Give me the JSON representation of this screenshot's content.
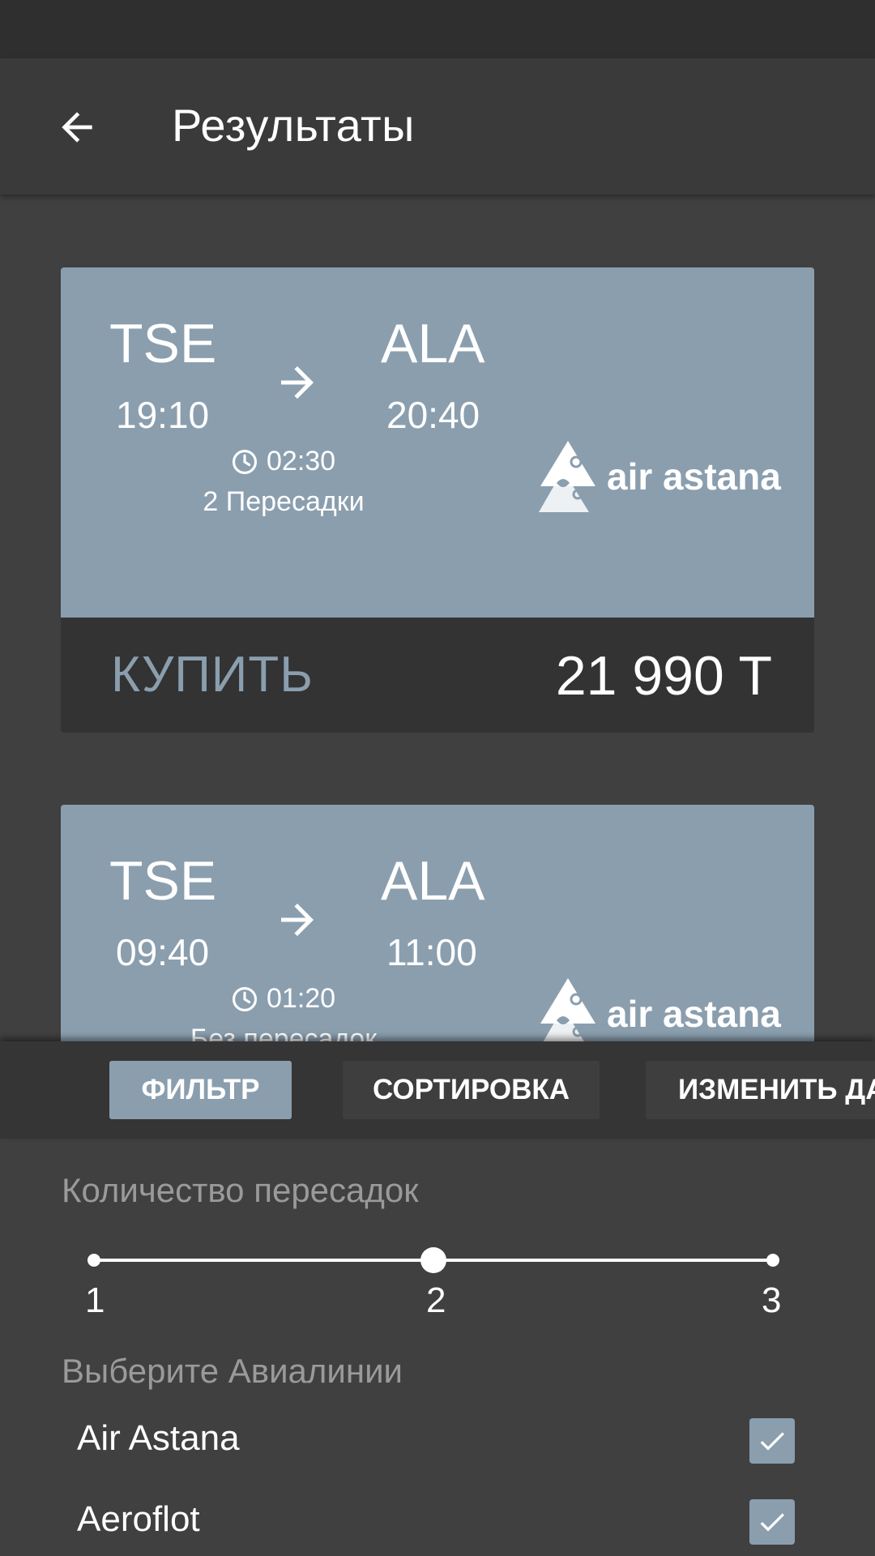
{
  "header": {
    "title": "Результаты"
  },
  "flights": [
    {
      "from_code": "TSE",
      "to_code": "ALA",
      "depart_time": "19:10",
      "arrive_time": "20:40",
      "duration": "02:30",
      "stops": "2 Пересадки",
      "airline": "air astana",
      "buy_label": "КУПИТЬ",
      "price": "21 990 T"
    },
    {
      "from_code": "TSE",
      "to_code": "ALA",
      "depart_time": "09:40",
      "arrive_time": "11:00",
      "duration": "01:20",
      "stops": "Без пересадок",
      "airline": "air astana"
    }
  ],
  "tabs": [
    {
      "label": "ФИЛЬТР",
      "active": true
    },
    {
      "label": "СОРТИРОВКА",
      "active": false
    },
    {
      "label": "ИЗМЕНИТЬ ДАТУ",
      "active": false
    }
  ],
  "filter": {
    "stops_label": "Количество пересадок",
    "stops_ticks": [
      "1",
      "2",
      "3"
    ],
    "stops_selected": "2",
    "airlines_label": "Выберите Авиалинии",
    "airlines": [
      {
        "name": "Air Astana",
        "checked": true
      },
      {
        "name": "Aeroflot",
        "checked": true
      }
    ]
  },
  "colors": {
    "accent": "#8a9eae",
    "background": "#404040",
    "app_bar": "#3a3a3a",
    "card_footer": "#333333"
  },
  "icons": {
    "back": "arrow-left-icon",
    "route": "arrow-right-icon",
    "duration": "clock-icon",
    "check": "checkmark-icon"
  }
}
